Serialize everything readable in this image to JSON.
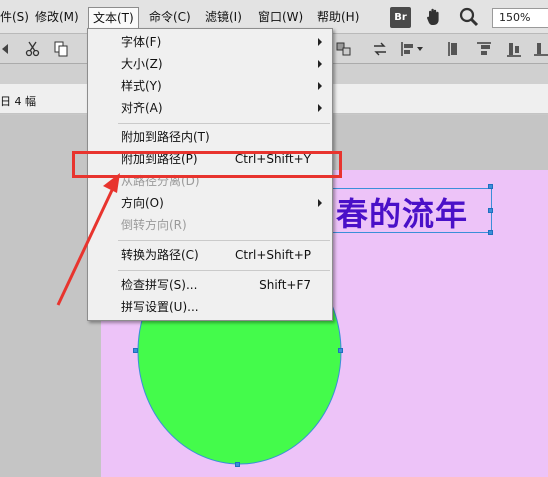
{
  "menubar": {
    "items": [
      "件(S)",
      "修改(M)",
      "文本(T)",
      "命令(C)",
      "滤镜(I)",
      "窗口(W)",
      "帮助(H)"
    ],
    "br_label": "Br",
    "zoom_value": "150%"
  },
  "docbar": {
    "page_count": "日 4 幅"
  },
  "canvas": {
    "path_text": "春的流年"
  },
  "dropdown": {
    "items": [
      {
        "label": "字体(F)",
        "shortcut": "",
        "submenu": true,
        "disabled": false
      },
      {
        "label": "大小(Z)",
        "shortcut": "",
        "submenu": true,
        "disabled": false
      },
      {
        "label": "样式(Y)",
        "shortcut": "",
        "submenu": true,
        "disabled": false
      },
      {
        "label": "对齐(A)",
        "shortcut": "",
        "submenu": true,
        "disabled": false
      },
      {
        "label": "附加到路径内(T)",
        "shortcut": "",
        "submenu": false,
        "disabled": false
      },
      {
        "label": "附加到路径(P)",
        "shortcut": "Ctrl+Shift+Y",
        "submenu": false,
        "disabled": false
      },
      {
        "label": "从路径分离(D)",
        "shortcut": "",
        "submenu": false,
        "disabled": true
      },
      {
        "label": "方向(O)",
        "shortcut": "",
        "submenu": true,
        "disabled": false
      },
      {
        "label": "倒转方向(R)",
        "shortcut": "",
        "submenu": false,
        "disabled": true
      },
      {
        "label": "转换为路径(C)",
        "shortcut": "Ctrl+Shift+P",
        "submenu": false,
        "disabled": false
      },
      {
        "label": "检查拼写(S)...",
        "shortcut": "Shift+F7",
        "submenu": false,
        "disabled": false
      },
      {
        "label": "拼写设置(U)...",
        "shortcut": "",
        "submenu": false,
        "disabled": false
      }
    ]
  },
  "colors": {
    "artboard": "#edc3f8",
    "circle_fill": "#44fb4b",
    "path_text": "#4a10c8",
    "highlight": "#e8342e",
    "selection": "#3a8fd9"
  },
  "icons": [
    "hand-icon",
    "zoom-icon",
    "cut-icon",
    "copy-icon",
    "align-icon",
    "group-icon"
  ]
}
